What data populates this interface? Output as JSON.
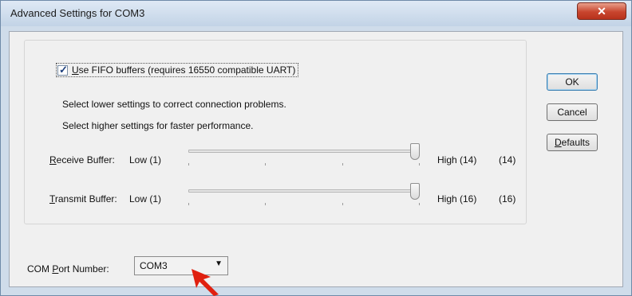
{
  "window": {
    "title": "Advanced Settings for COM3",
    "close_glyph": "✕"
  },
  "fifo": {
    "checked": true,
    "label_access_key": "U",
    "label_rest": "se FIFO buffers (requires 16550 compatible UART)"
  },
  "notes": {
    "line1": "Select lower settings to correct connection problems.",
    "line2": "Select higher settings for faster performance."
  },
  "receive": {
    "label_access_key": "R",
    "label_rest": "eceive Buffer:",
    "low": "Low (1)",
    "high": "High (14)",
    "value_display": "(14)",
    "min": 1,
    "max": 14,
    "value": 14
  },
  "transmit": {
    "label_access_key": "T",
    "label_rest": "ransmit Buffer:",
    "low": "Low (1)",
    "high": "High (16)",
    "value_display": "(16)",
    "min": 1,
    "max": 16,
    "value": 16
  },
  "buttons": {
    "ok": "OK",
    "cancel": "Cancel",
    "defaults_access_key": "D",
    "defaults_rest": "efaults"
  },
  "com_port": {
    "label_prefix": "COM ",
    "label_access_key": "P",
    "label_rest": "ort Number:",
    "selected": "COM3"
  },
  "colors": {
    "annotation_arrow": "#e0200f"
  }
}
